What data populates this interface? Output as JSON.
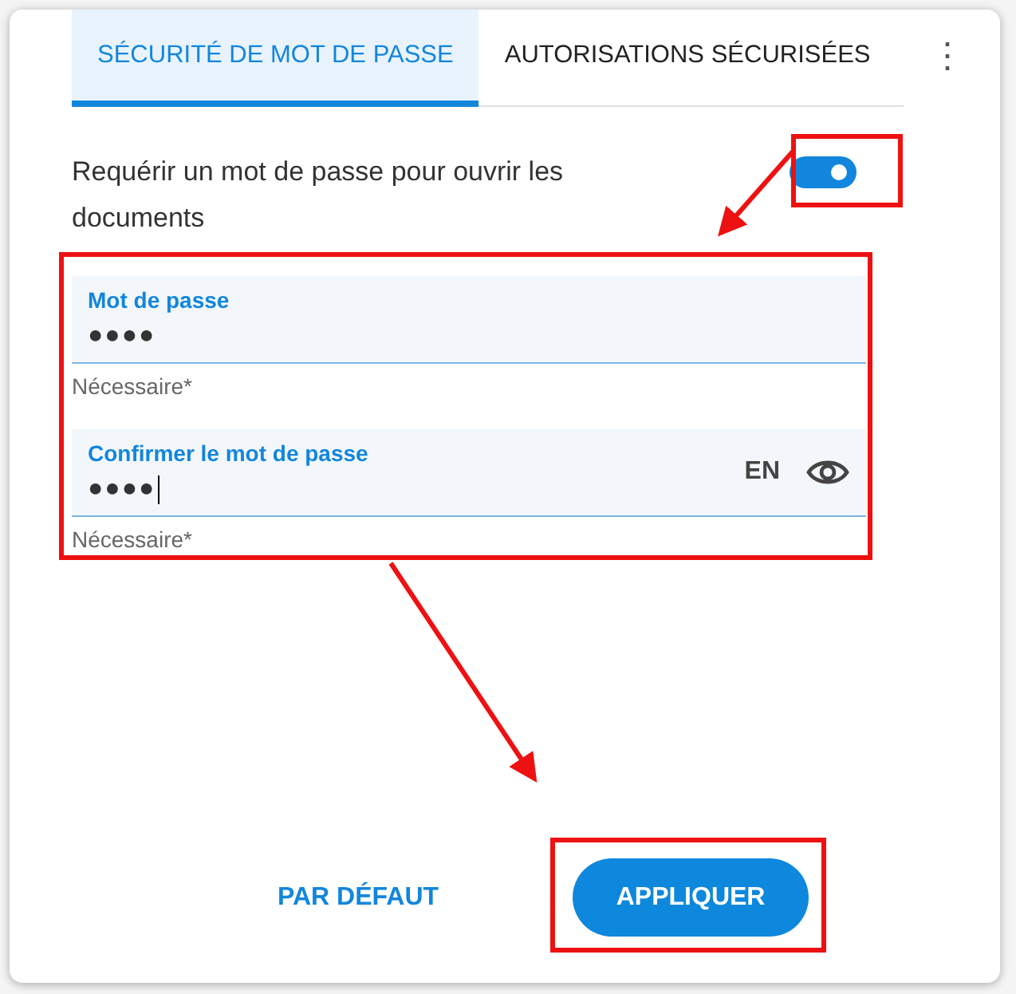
{
  "tabs": [
    {
      "label": "SÉCURITÉ DE MOT DE PASSE",
      "selected": true
    },
    {
      "label": "AUTORISATIONS SÉCURISÉES",
      "selected": false
    }
  ],
  "menu_icon": "⋮",
  "require_password": {
    "label": "Requérir un mot de passe pour ouvrir les documents",
    "on": true
  },
  "fields": [
    {
      "label": "Mot de passe",
      "value": "●●●●",
      "helper": "Nécessaire*",
      "focused": false,
      "show_eye": false
    },
    {
      "label": "Confirmer le mot de passe",
      "value": "●●●●",
      "helper": "Nécessaire*",
      "focused": true,
      "language": "EN",
      "show_eye": true
    }
  ],
  "buttons": [
    {
      "label": "PAR DÉFAUT",
      "kind": "text"
    },
    {
      "label": "APPLIQUER",
      "kind": "primary"
    }
  ]
}
